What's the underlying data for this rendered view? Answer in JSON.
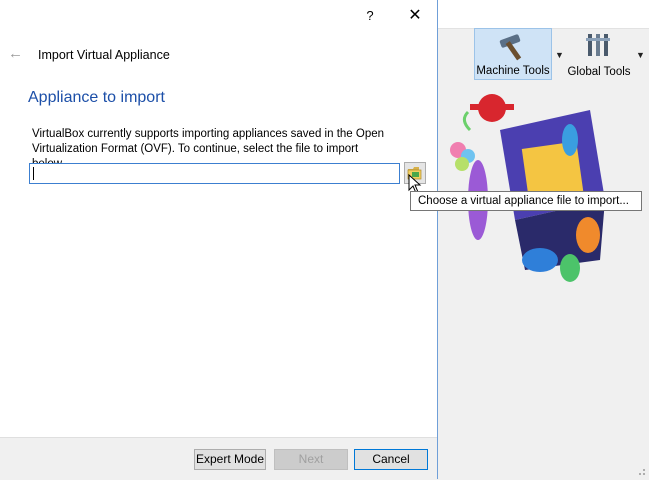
{
  "dialog": {
    "help_label": "?",
    "close_label": "✕",
    "back_label": "←",
    "wizard_title": "Import Virtual Appliance",
    "page_heading": "Appliance to import",
    "description": "VirtualBox currently supports importing appliances saved in the Open Virtualization Format (OVF). To continue, select the file to import below.",
    "file_input_value": "",
    "tooltip": "Choose a virtual appliance file to import...",
    "buttons": {
      "expert": "Expert Mode",
      "next": "Next",
      "cancel": "Cancel"
    }
  },
  "manager": {
    "machine_tools": "Machine Tools",
    "global_tools": "Global Tools"
  },
  "colors": {
    "heading": "#1c4fa8",
    "input_border": "#3c7fd0",
    "selected_tool_bg": "#cfe3f6"
  }
}
